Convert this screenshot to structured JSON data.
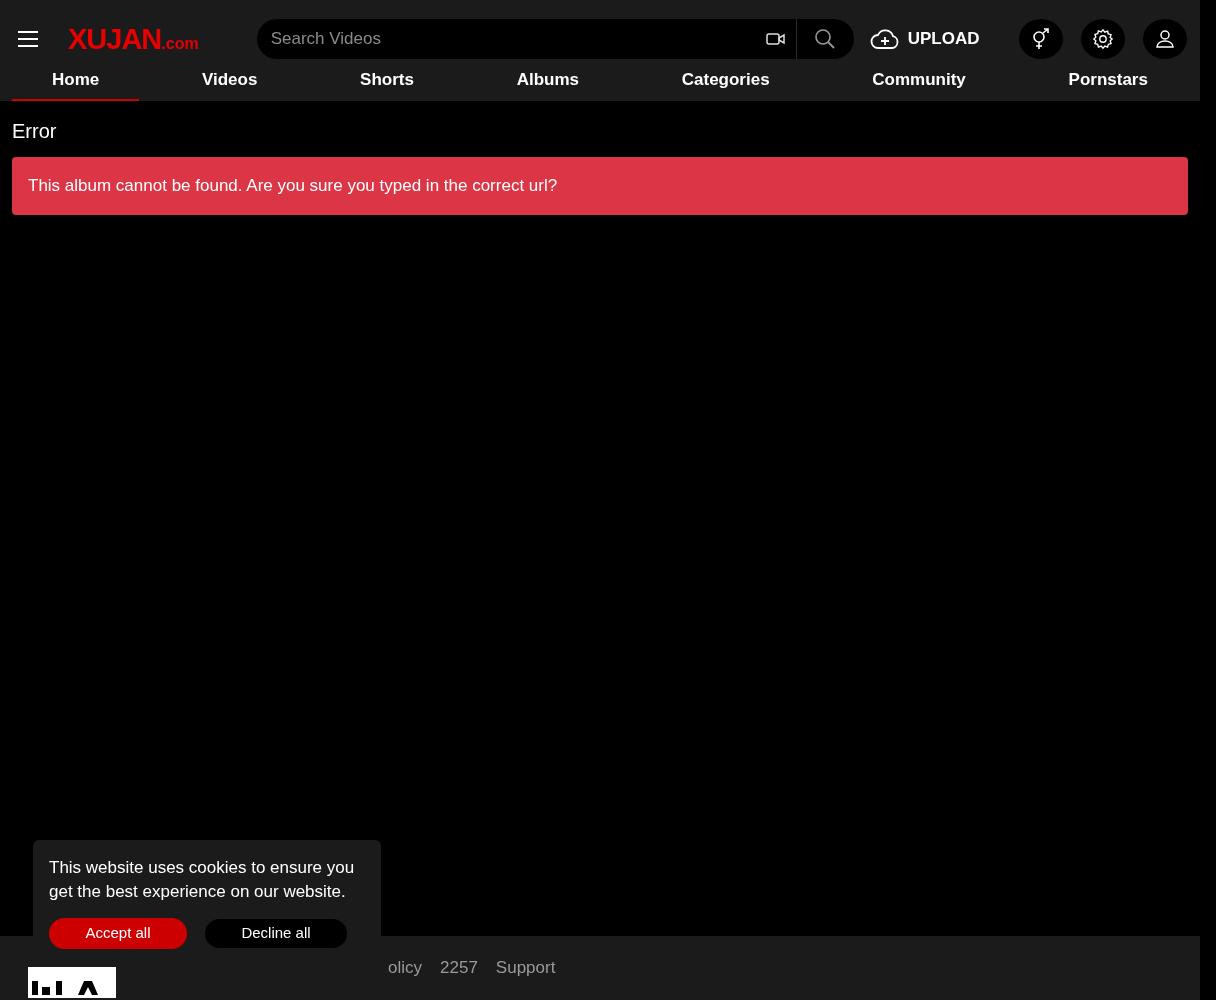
{
  "header": {
    "logo": {
      "main": "XUJAN",
      "suffix": ".com"
    },
    "search": {
      "placeholder": "Search Videos"
    },
    "upload": "UPLOAD"
  },
  "tabs": [
    {
      "label": "Home",
      "selected": true
    },
    {
      "label": "Videos",
      "selected": false
    },
    {
      "label": "Shorts",
      "selected": false
    },
    {
      "label": "Albums",
      "selected": false
    },
    {
      "label": "Categories",
      "selected": false
    },
    {
      "label": "Community",
      "selected": false
    },
    {
      "label": "Pornstars",
      "selected": false
    }
  ],
  "page": {
    "title": "Error",
    "alert": "This album cannot be found. Are you sure you typed in the correct url?"
  },
  "footer": {
    "links": [
      "olicy",
      "2257",
      "Support"
    ]
  },
  "cookie_popup": {
    "text": "This website uses cookies to ensure you get the best experience on our website.",
    "accept": "Accept all",
    "decline": "Decline all"
  }
}
